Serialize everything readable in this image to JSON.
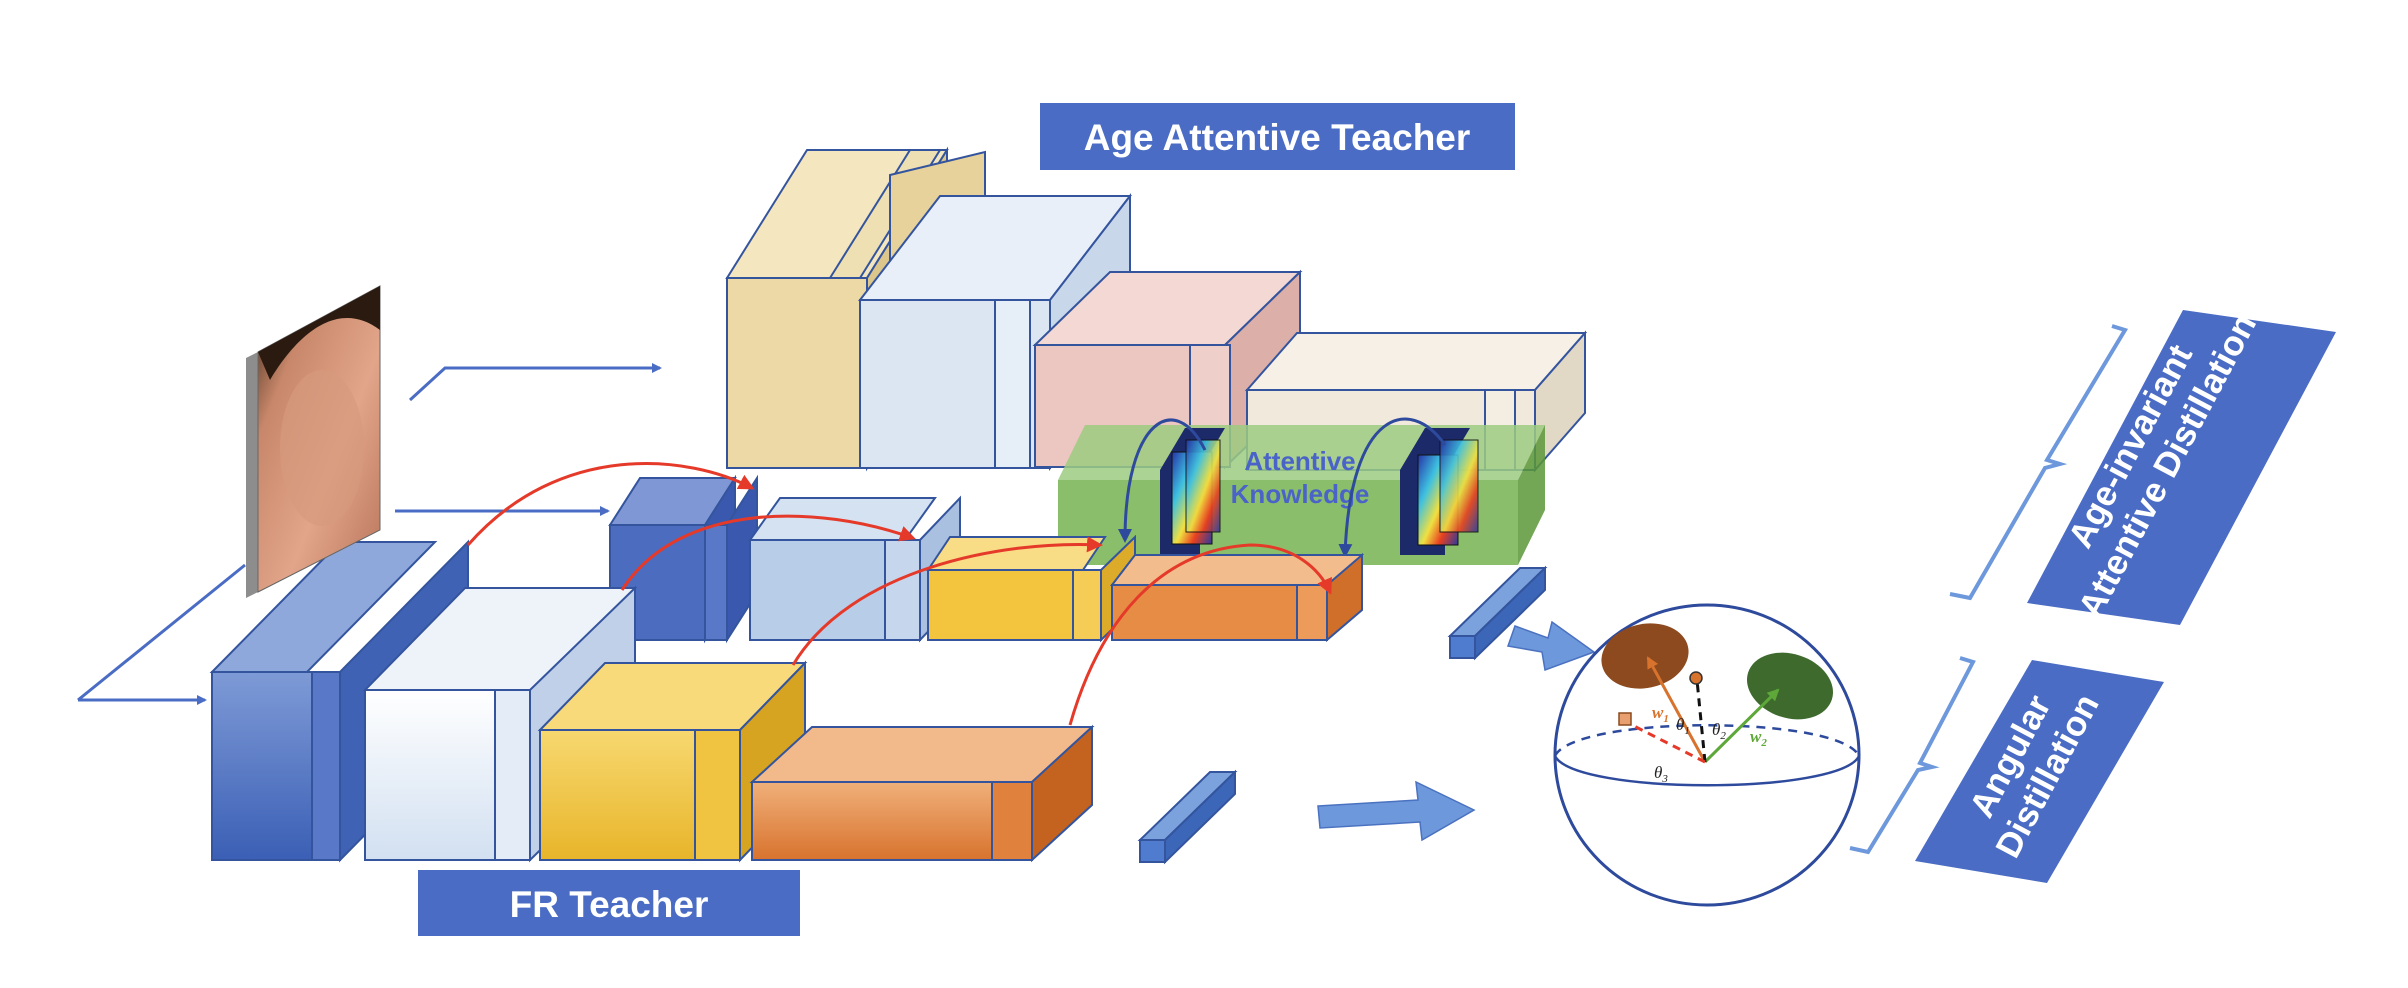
{
  "labels": {
    "age_teacher": "Age Attentive Teacher",
    "fr_teacher": "FR Teacher",
    "attentive_knowledge_line1": "Attentive",
    "attentive_knowledge_line2": "Knowledge",
    "age_invariant_line1": "Age-invariant",
    "age_invariant_line2": "Attentive Distillation",
    "angular_line1": "Angular",
    "angular_line2": "Distillation"
  },
  "sphere": {
    "w1": "w",
    "w1_sub": "1",
    "w2": "w",
    "w2_sub": "2",
    "theta1": "θ",
    "theta1_sub": "1",
    "theta2": "θ",
    "theta2_sub": "2",
    "theta3": "θ",
    "theta3_sub": "3"
  },
  "colors": {
    "label_box": "#4a6cc4",
    "fr_blue": "#4466bb",
    "fr_pale": "#dde8f5",
    "fr_yellow": "#f3c43e",
    "fr_orange": "#e0823d",
    "teacher_beige": "#ecd9a6",
    "teacher_ice": "#dbe6f2",
    "teacher_pink": "#ecc6c1",
    "teacher_cream": "#f0e9dc",
    "attention_green": "#72b04a",
    "arrow_red": "#e53a2a",
    "arrow_blue": "#4a6cc4",
    "ellipse_brown": "#8c4a1e",
    "ellipse_green": "#3e6a2e"
  }
}
